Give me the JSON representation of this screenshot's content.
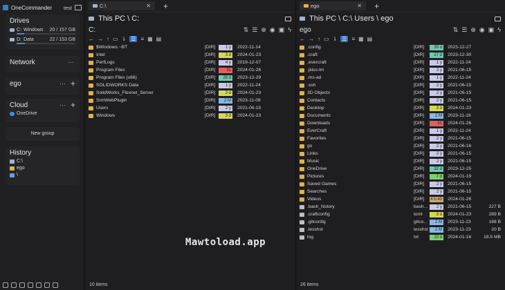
{
  "app": {
    "title": "OneCommander",
    "workspace": "test"
  },
  "drives": {
    "title": "Drives",
    "items": [
      {
        "letter": "C:",
        "name": "Windows",
        "size": "20 / 157 GB",
        "used": 0.13
      },
      {
        "letter": "D:",
        "name": "Data",
        "size": "22 / 153 GB",
        "used": 0.14
      }
    ]
  },
  "network": {
    "title": "Network"
  },
  "ego": {
    "title": "ego"
  },
  "cloud": {
    "title": "Cloud",
    "items": [
      "OneDrive"
    ]
  },
  "newgroup": "New group",
  "history": {
    "title": "History",
    "items": [
      "C:\\",
      "ego",
      "\\"
    ]
  },
  "left": {
    "tab": "C:\\",
    "path": "This PC \\ C:",
    "sub": "C:",
    "status": "10 items",
    "rows": [
      {
        "n": "$Windows.~BT",
        "e": "[DIR]",
        "a": "1 y",
        "c": "#c9c9e8",
        "d": "2022-11-14"
      },
      {
        "n": "Intel",
        "e": "[DIR]",
        "a": "3 d",
        "c": "#d6d65a",
        "d": "2024-01-23"
      },
      {
        "n": "PerfLogs",
        "e": "[DIR]",
        "a": "4 y",
        "c": "#c9c9e8",
        "d": "2019-12-07"
      },
      {
        "n": "Program Files",
        "e": "[DIR]",
        "a": "31",
        "c": "#e06060",
        "d": "2024-01-26"
      },
      {
        "n": "Program Files (x86)",
        "e": "[DIR]",
        "a": "28 d",
        "c": "#6cc9b0",
        "d": "2023-12-29"
      },
      {
        "n": "SOLIDWORKS Data",
        "e": "[DIR]",
        "a": "1 y",
        "c": "#c9c9e8",
        "d": "2022-11-24"
      },
      {
        "n": "SolidWorks_Flexnet_Server",
        "e": "[DIR]",
        "a": "3 d",
        "c": "#d6d65a",
        "d": "2024-01-23"
      },
      {
        "n": "SrmWebPlugin",
        "e": "[DIR]",
        "a": "2 M",
        "c": "#8ab8e0",
        "d": "2023-11-08"
      },
      {
        "n": "Users",
        "e": "[DIR]",
        "a": "2 y",
        "c": "#c9c9e8",
        "d": "2021-06-15"
      },
      {
        "n": "Windows",
        "e": "[DIR]",
        "a": "3 d",
        "c": "#d6d65a",
        "d": "2024-01-23"
      }
    ]
  },
  "right": {
    "tab": "ego",
    "path": "This PC \\ C:\\ Users \\ ego",
    "sub": "ego",
    "status": "26 items",
    "rows": [
      {
        "n": ".config",
        "e": "[DIR]",
        "a": "30 d",
        "c": "#6cc9b0",
        "d": "2023-12-27",
        "s": ""
      },
      {
        "n": ".craft",
        "e": "[DIR]",
        "a": "27 d",
        "c": "#6cc9b0",
        "d": "2023-12-30",
        "s": ""
      },
      {
        "n": ".evercraft",
        "e": "[DIR]",
        "a": "1 y",
        "c": "#c9c9e8",
        "d": "2022-11-24",
        "s": ""
      },
      {
        "n": ".jkiss-lm",
        "e": "[DIR]",
        "a": "2 y",
        "c": "#c9c9e8",
        "d": "2021-06-15",
        "s": ""
      },
      {
        "n": ".ms-ad",
        "e": "[DIR]",
        "a": "1 y",
        "c": "#c9c9e8",
        "d": "2022-11-24",
        "s": ""
      },
      {
        "n": ".ssh",
        "e": "[DIR]",
        "a": "2 y",
        "c": "#c9c9e8",
        "d": "2021-06-15",
        "s": ""
      },
      {
        "n": "3D Objects",
        "e": "[DIR]",
        "a": "2 y",
        "c": "#c9c9e8",
        "d": "2021-06-15",
        "s": ""
      },
      {
        "n": "Contacts",
        "e": "[DIR]",
        "a": "2 y",
        "c": "#c9c9e8",
        "d": "2021-06-15",
        "s": ""
      },
      {
        "n": "Desktop",
        "e": "[DIR]",
        "a": "3 d",
        "c": "#d6d65a",
        "d": "2024-01-23",
        "s": ""
      },
      {
        "n": "Documents",
        "e": "[DIR]",
        "a": "2 M",
        "c": "#8ab8e0",
        "d": "2023-11-16",
        "s": ""
      },
      {
        "n": "Downloads",
        "e": "[DIR]",
        "a": "31",
        "c": "#e06060",
        "d": "2024-01-26",
        "s": ""
      },
      {
        "n": "EverCraft",
        "e": "[DIR]",
        "a": "1 y",
        "c": "#c9c9e8",
        "d": "2022-11-24",
        "s": ""
      },
      {
        "n": "Favorites",
        "e": "[DIR]",
        "a": "2 y",
        "c": "#c9c9e8",
        "d": "2021-06-15",
        "s": ""
      },
      {
        "n": "go",
        "e": "[DIR]",
        "a": "2 y",
        "c": "#c9c9e8",
        "d": "2021-06-16",
        "s": ""
      },
      {
        "n": "Links",
        "e": "[DIR]",
        "a": "2 y",
        "c": "#c9c9e8",
        "d": "2021-06-15",
        "s": ""
      },
      {
        "n": "Music",
        "e": "[DIR]",
        "a": "2 y",
        "c": "#c9c9e8",
        "d": "2021-06-15",
        "s": ""
      },
      {
        "n": "OneDrive",
        "e": "[DIR]",
        "a": "32 d",
        "c": "#6cc9b0",
        "d": "2023-12-25",
        "s": ""
      },
      {
        "n": "Pictures",
        "e": "[DIR]",
        "a": "7 d",
        "c": "#7ccf70",
        "d": "2024-01-19",
        "s": ""
      },
      {
        "n": "Saved Games",
        "e": "[DIR]",
        "a": "2 y",
        "c": "#c9c9e8",
        "d": "2021-06-15",
        "s": ""
      },
      {
        "n": "Searches",
        "e": "[DIR]",
        "a": "2 y",
        "c": "#c9c9e8",
        "d": "2021-06-15",
        "s": ""
      },
      {
        "n": "Videos",
        "e": "[DIR]",
        "a": "4 h 40",
        "c": "#c8a86a",
        "d": "2024-01-26",
        "s": ""
      },
      {
        "n": ".bash_history",
        "e": "bash...",
        "a": "2 y",
        "c": "#c9c9e8",
        "d": "2021-06-15",
        "s": "227 B"
      },
      {
        "n": ".craftconfig",
        "e": "toml",
        "a": "3 d",
        "c": "#d6d65a",
        "d": "2024-01-23",
        "s": "289 B"
      },
      {
        "n": ".gitconfig",
        "e": "gitco...",
        "a": "2 M",
        "c": "#8ab8e0",
        "d": "2023-11-23",
        "s": "188 B"
      },
      {
        "n": ".lesshst",
        "e": "lesshst",
        "a": "2 M",
        "c": "#8ab8e0",
        "d": "2023-11-23",
        "s": "20 B"
      },
      {
        "n": "log",
        "e": "txt",
        "a": "10 d",
        "c": "#7ccf70",
        "d": "2024-01-16",
        "s": "18.5 MB"
      }
    ]
  },
  "watermark": "Mawtoload.app"
}
